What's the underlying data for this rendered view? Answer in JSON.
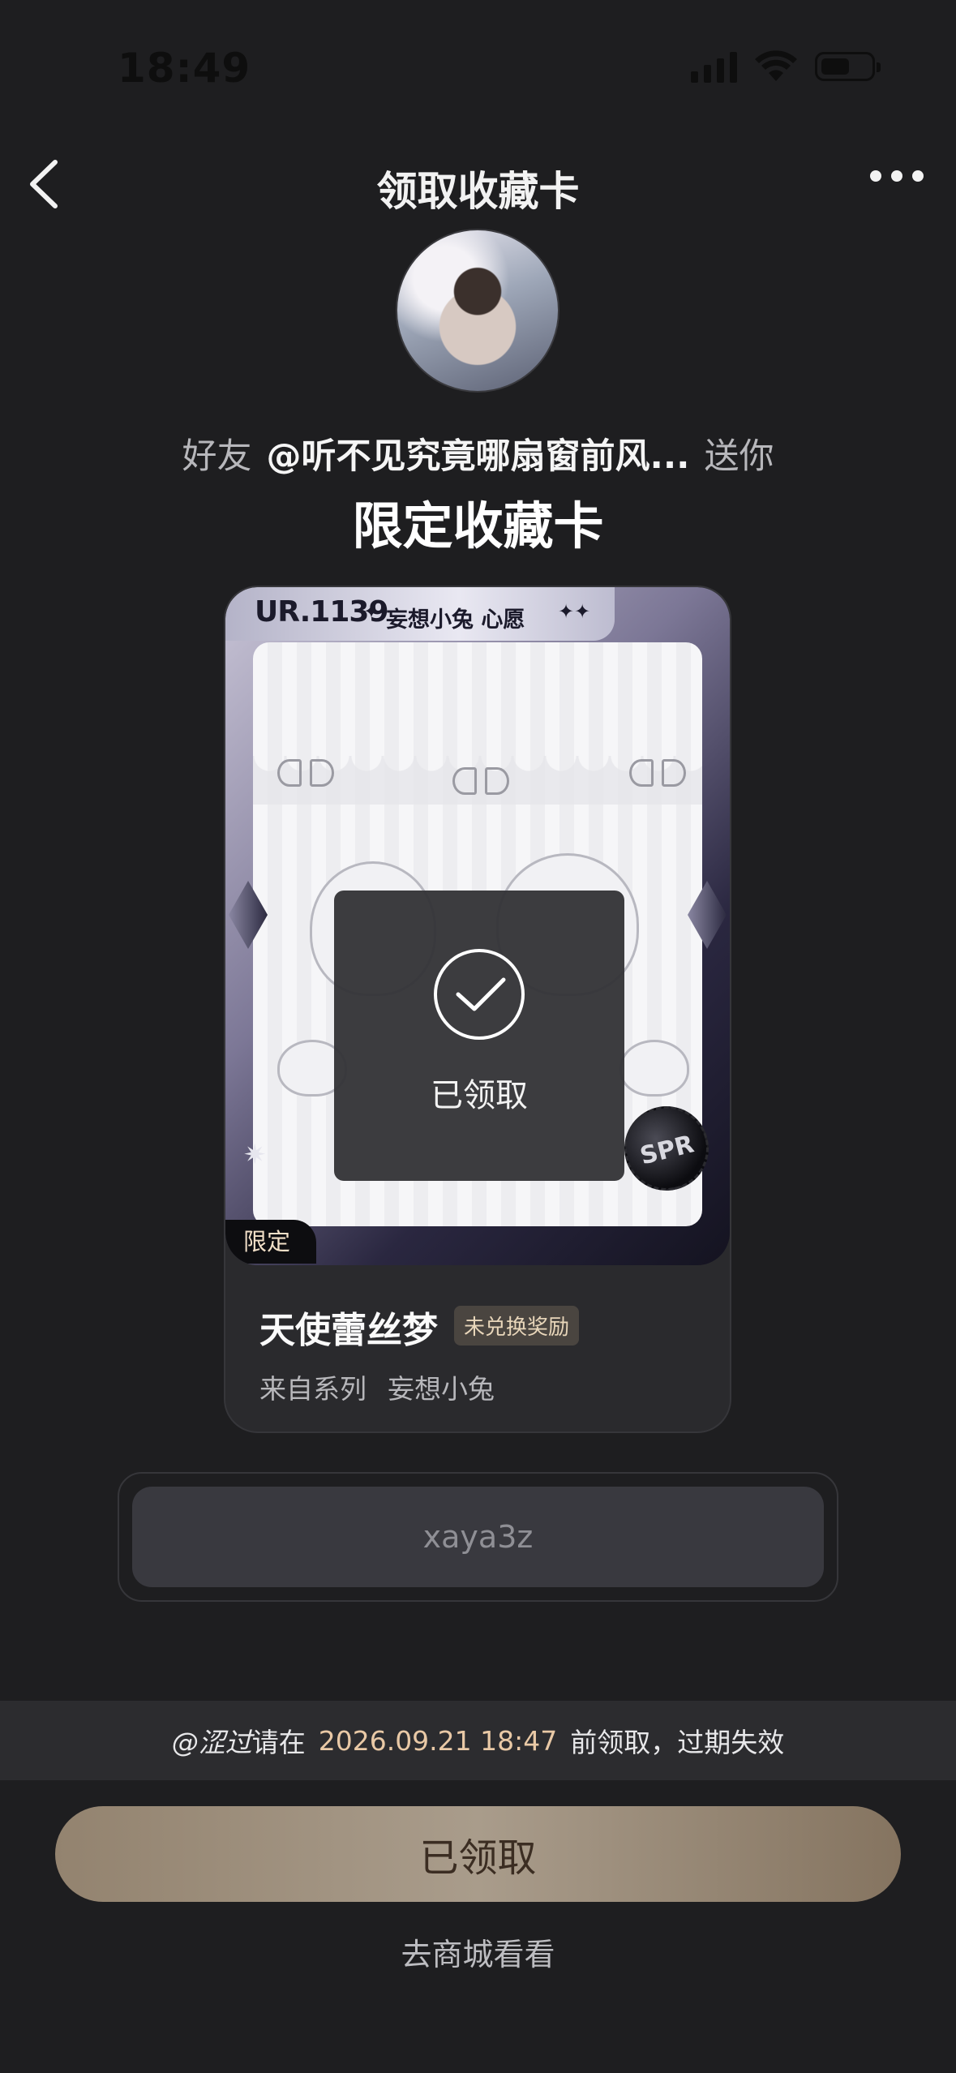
{
  "status_bar": {
    "time": "18:49"
  },
  "nav": {
    "title": "领取收藏卡"
  },
  "header": {
    "friend_prefix": "好友",
    "friend_name": "@听不见究竟哪扇窗前风...",
    "friend_suffix": "送你",
    "subtitle": "限定收藏卡"
  },
  "card": {
    "rank_label": "UR.1139",
    "series_label": "妄想小兔 心愿",
    "limited_tag": "限定",
    "rarity_badge": "SPR",
    "claimed_overlay": "已领取",
    "name": "天使蕾丝梦",
    "reward_badge": "未兑换奖励",
    "series_prefix": "来自系列",
    "series_name": "妄想小兔"
  },
  "code": {
    "value": "xaya3z"
  },
  "deadline": {
    "user": "@涩过",
    "prefix": "请在",
    "date": "2026.09.21 18:47",
    "suffix": "前领取，过期失效"
  },
  "actions": {
    "claim_button": "已领取",
    "shop_link": "去商城看看"
  },
  "colors": {
    "background": "#1e1e20",
    "accent_gold": "#e9c9a6",
    "button_gradient": "#93836f"
  }
}
